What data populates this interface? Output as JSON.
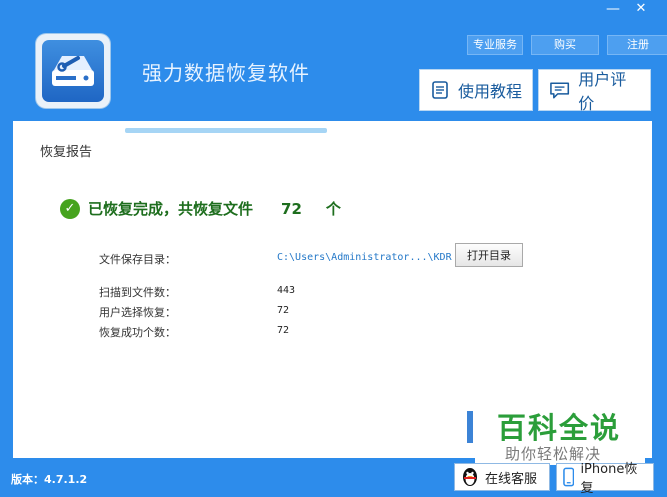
{
  "window": {
    "minimize_icon": "minimize-icon",
    "close_icon": "close-icon"
  },
  "header": {
    "app_title": "强力数据恢复软件",
    "links": [
      "专业服务",
      "购买",
      "注册"
    ],
    "buttons": [
      {
        "label": "使用教程",
        "icon": "book-icon"
      },
      {
        "label": "用户评价",
        "icon": "comment-icon"
      }
    ]
  },
  "report": {
    "title": "恢复报告",
    "status_text": "已恢复完成，共恢复文件",
    "status_count": "72",
    "status_unit": "个",
    "save_dir_label": "文件保存目录：",
    "save_dir_value": "C:\\Users\\Administrator...\\KDR",
    "open_dir_button": "打开目录",
    "scanned_label": "扫描到文件数：",
    "scanned_value": "443",
    "selected_label": "用户选择恢复：",
    "selected_value": "72",
    "success_label": "恢复成功个数：",
    "success_value": "72"
  },
  "watermark": {
    "title": "百科全说",
    "subtitle": "助你轻松解决"
  },
  "footer": {
    "version": "版本：4.7.1.2",
    "online_service": "在线客服",
    "iphone_recovery": "iPhone恢复"
  },
  "colors": {
    "background": "#2d8ceb",
    "accent": "#1a5c9e",
    "success": "#46a31e"
  }
}
